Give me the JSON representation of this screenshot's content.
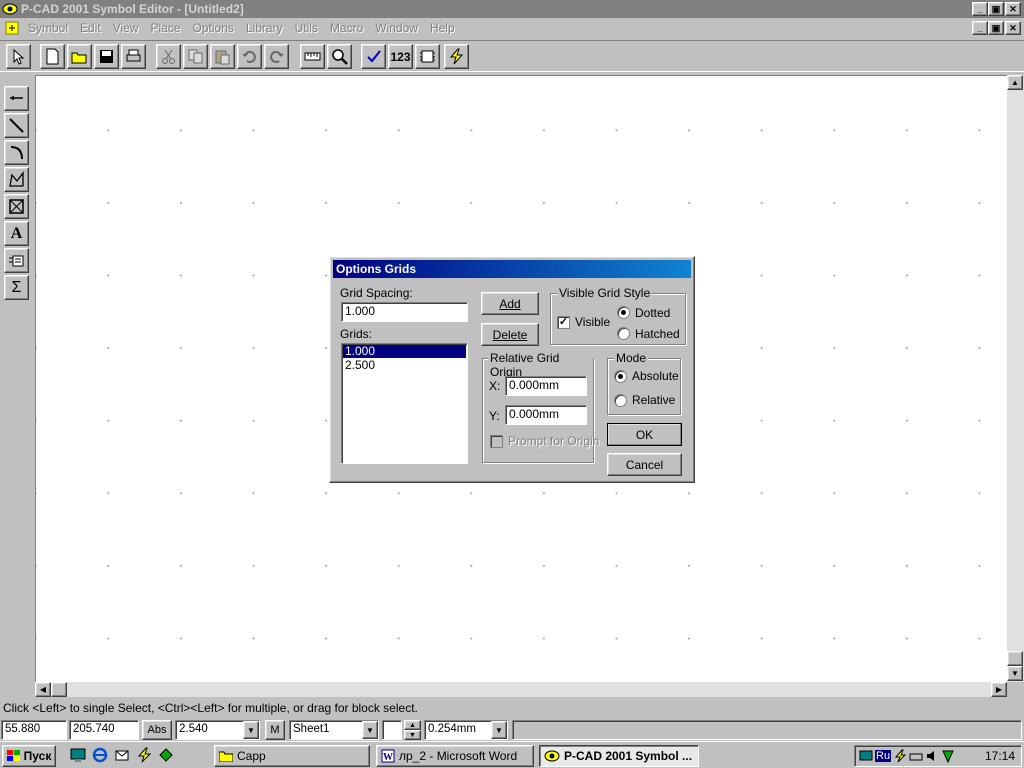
{
  "window": {
    "title": "P-CAD 2001 Symbol Editor - [Untitled2]"
  },
  "menu": [
    "Symbol",
    "Edit",
    "View",
    "Place",
    "Options",
    "Library",
    "Utils",
    "Macro",
    "Window",
    "Help"
  ],
  "toolbar": {
    "counter_label": "123"
  },
  "canvas": {
    "background": "#ffffff",
    "grid_dot_color": "#a8a8a8"
  },
  "dialog": {
    "title": "Options Grids",
    "grid_spacing_label": "Grid Spacing:",
    "grid_spacing_value": "1.000",
    "grids_label": "Grids:",
    "grids": [
      "1.000",
      "2.500"
    ],
    "selected_grid": "1.000",
    "add_label": "Add",
    "delete_label": "Delete",
    "visible_style_group": "Visible Grid Style",
    "visible_label": "Visible",
    "visible_checked": true,
    "dotted_label": "Dotted",
    "hatched_label": "Hatched",
    "style_selected": "Dotted",
    "origin_group": "Relative Grid Origin",
    "x_label": "X:",
    "x_value": "0.000mm",
    "y_label": "Y:",
    "y_value": "0.000mm",
    "prompt_label": "Prompt for Origin",
    "mode_group": "Mode",
    "absolute_label": "Absolute",
    "relative_label": "Relative",
    "mode_selected": "Absolute",
    "ok_label": "OK",
    "cancel_label": "Cancel",
    "title_color": "#000080"
  },
  "status": {
    "message": "Click <Left> to single Select, <Ctrl><Left> for multiple, or drag for block select.",
    "x_coord": "55.880",
    "y_coord": "205.740",
    "abs_label": "Abs",
    "grid_value": "2.540",
    "m_label": "M",
    "sheet": "Sheet1",
    "line_width": "0.254mm"
  },
  "taskbar": {
    "start_label": "Пуск",
    "tasks": [
      "Capp",
      "лр_2 - Microsoft Word",
      "P-CAD 2001 Symbol ..."
    ],
    "language": "Ru",
    "clock": "17:14"
  }
}
